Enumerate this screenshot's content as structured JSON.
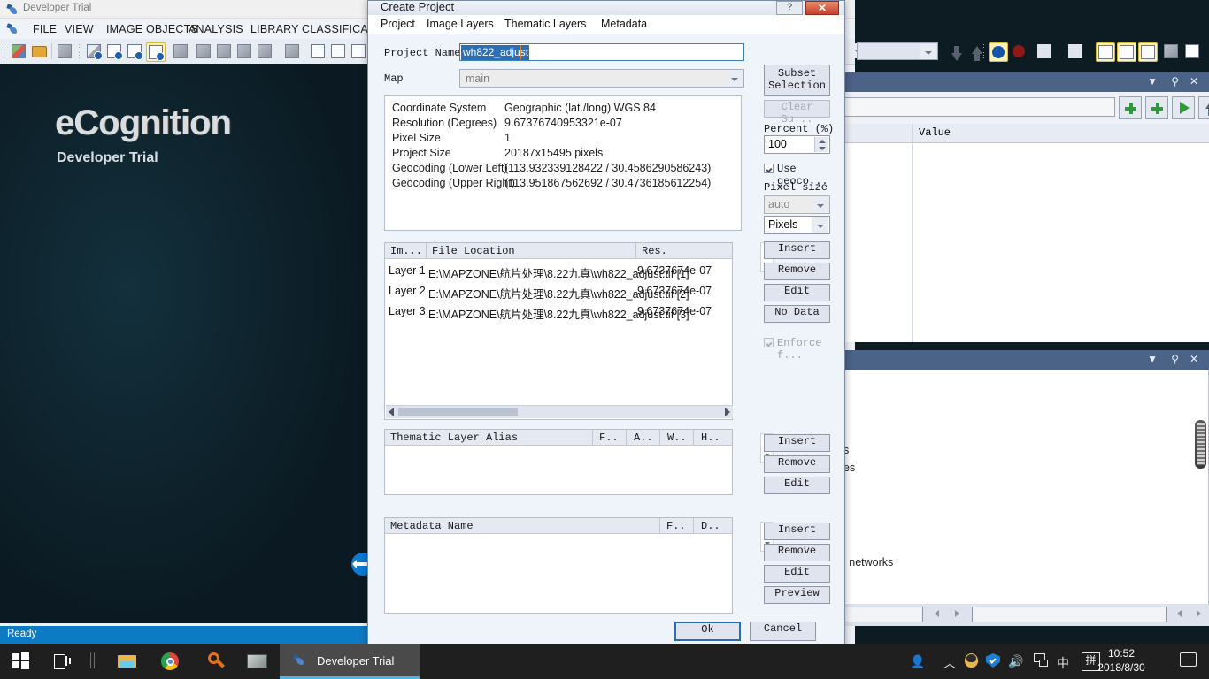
{
  "app": {
    "title": "Developer Trial",
    "menu": [
      "FILE",
      "VIEW",
      "IMAGE OBJECTS",
      "ANALYSIS",
      "LIBRARY",
      "CLASSIFICATION"
    ],
    "canvas": {
      "logo": "eCognition",
      "subtitle": "Developer Trial"
    },
    "status": "Ready"
  },
  "panel1": {
    "column_header_value": "Value"
  },
  "panel2": {
    "fragments": [
      "s",
      "es",
      "l networks"
    ]
  },
  "dialog": {
    "title": "Create Project",
    "help_label": "?",
    "close_label": "✕",
    "menu": [
      "Project",
      "Image Layers",
      "Thematic Layers",
      "Metadata"
    ],
    "project_name_label": "Project Name",
    "project_name_value": "wh822_adjust",
    "map_label": "Map",
    "map_value": "main",
    "info": [
      {
        "key": "Coordinate System",
        "value": "Geographic (lat./long)  WGS 84"
      },
      {
        "key": "Resolution (Degrees)",
        "value": "9.67376740953321e-07"
      },
      {
        "key": "Pixel Size",
        "value": "1"
      },
      {
        "key": "Project Size",
        "value": "20187x15495 pixels"
      },
      {
        "key": "Geocoding (Lower Left)",
        "value": "(113.932339128422 / 30.4586290586243)"
      },
      {
        "key": "Geocoding (Upper Right)",
        "value": "(113.951867562692 / 30.4736185612254)"
      }
    ],
    "image_layers": {
      "headers": [
        "Im...",
        "File Location",
        "Res."
      ],
      "rows": [
        {
          "im": "Layer 1",
          "file": "E:\\MAPZONE\\航片处理\\8.22九真\\wh822_adjust.tif [1]",
          "res": "9.6737674e-07"
        },
        {
          "im": "Layer 2",
          "file": "E:\\MAPZONE\\航片处理\\8.22九真\\wh822_adjust.tif [2]",
          "res": "9.6737674e-07"
        },
        {
          "im": "Layer 3",
          "file": "E:\\MAPZONE\\航片处理\\8.22九真\\wh822_adjust.tif [3]",
          "res": "9.6737674e-07"
        }
      ]
    },
    "thematic_layers": {
      "headers": [
        "Thematic Layer Alias",
        "F..",
        "A..",
        "W..",
        "H.."
      ]
    },
    "metadata": {
      "headers": [
        "Metadata Name",
        "F..",
        "D.."
      ]
    },
    "right_panel": {
      "subset_selection": "Subset\nSelection",
      "subset_selection_line1": "Subset",
      "subset_selection_line2": "Selection",
      "clear_subset": "Clear Su...",
      "percent_label": "Percent (%)",
      "percent_value": "100",
      "use_geocoding": "Use geoco...",
      "pixel_size_label": "Pixel size",
      "pixel_size_value": "auto",
      "pixel_unit_value": "Pixels",
      "insert": "Insert",
      "remove": "Remove",
      "edit": "Edit",
      "no_data": "No Data",
      "enforce": "Enforce f...",
      "preview": "Preview"
    },
    "ok": "Ok",
    "cancel": "Cancel"
  },
  "taskbar": {
    "task_label": "Developer Trial",
    "time": "10:52",
    "date": "2018/8/30",
    "ime_lang": "中",
    "ime_mode": "拼"
  }
}
